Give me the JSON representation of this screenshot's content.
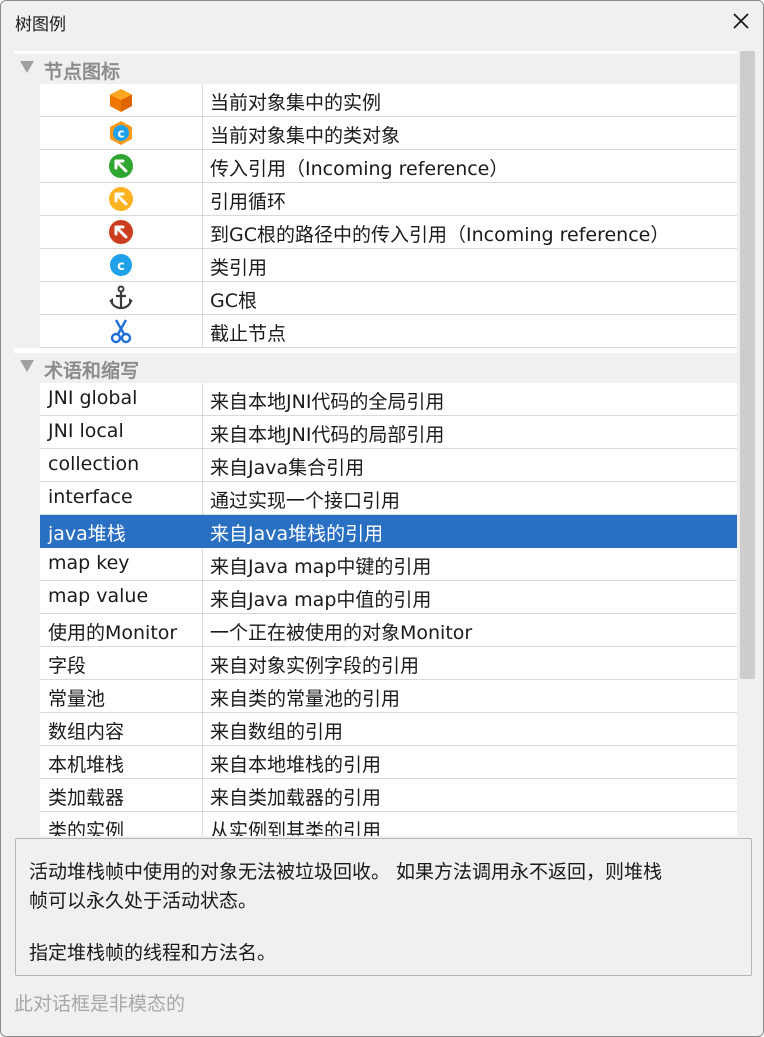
{
  "window": {
    "title": "树图例"
  },
  "sections": [
    {
      "title": "节点图标"
    },
    {
      "title": "术语和缩写"
    }
  ],
  "icon_rows": [
    {
      "icon": "cube-orange-icon",
      "label": "当前对象集中的实例"
    },
    {
      "icon": "class-object-icon",
      "label": "当前对象集中的类对象"
    },
    {
      "icon": "incoming-reference-green-icon",
      "label": "传入引用（Incoming reference）"
    },
    {
      "icon": "reference-cycle-yellow-icon",
      "label": "引用循环"
    },
    {
      "icon": "gc-root-path-red-icon",
      "label": "到GC根的路径中的传入引用（Incoming reference）"
    },
    {
      "icon": "class-reference-icon",
      "label": "类引用"
    },
    {
      "icon": "anchor-icon",
      "label": "GC根"
    },
    {
      "icon": "scissors-icon",
      "label": "截止节点"
    }
  ],
  "term_rows": [
    {
      "term": "JNI global",
      "meaning": "来自本地JNI代码的全局引用"
    },
    {
      "term": "JNI local",
      "meaning": "来自本地JNI代码的局部引用"
    },
    {
      "term": "collection",
      "meaning": "来自Java集合引用"
    },
    {
      "term": "interface",
      "meaning": "通过实现一个接口引用"
    },
    {
      "term": "java堆栈",
      "meaning": "来自Java堆栈的引用",
      "selected": true
    },
    {
      "term": "map key",
      "meaning": "来自Java map中键的引用"
    },
    {
      "term": "map value",
      "meaning": "来自Java map中值的引用"
    },
    {
      "term": "使用的Monitor",
      "meaning": "一个正在被使用的对象Monitor"
    },
    {
      "term": "字段",
      "meaning": "来自对象实例字段的引用"
    },
    {
      "term": "常量池",
      "meaning": "来自类的常量池的引用"
    },
    {
      "term": "数组内容",
      "meaning": "来自数组的引用"
    },
    {
      "term": "本机堆栈",
      "meaning": "来自本地堆栈的引用"
    },
    {
      "term": "类加载器",
      "meaning": "来自类加载器的引用"
    },
    {
      "term": "类的实例",
      "meaning": "从实例到其类的引用"
    }
  ],
  "description": {
    "line1": "活动堆栈帧中使用的对象无法被垃圾回收。 如果方法调用永不返回，则堆栈",
    "line2": "帧可以永久处于活动状态。",
    "line3": "指定堆栈帧的线程和方法名。"
  },
  "footer": "此对话框是非模态的",
  "colors": {
    "selection": "#2a70c2",
    "header_text": "#8c8c8c"
  }
}
